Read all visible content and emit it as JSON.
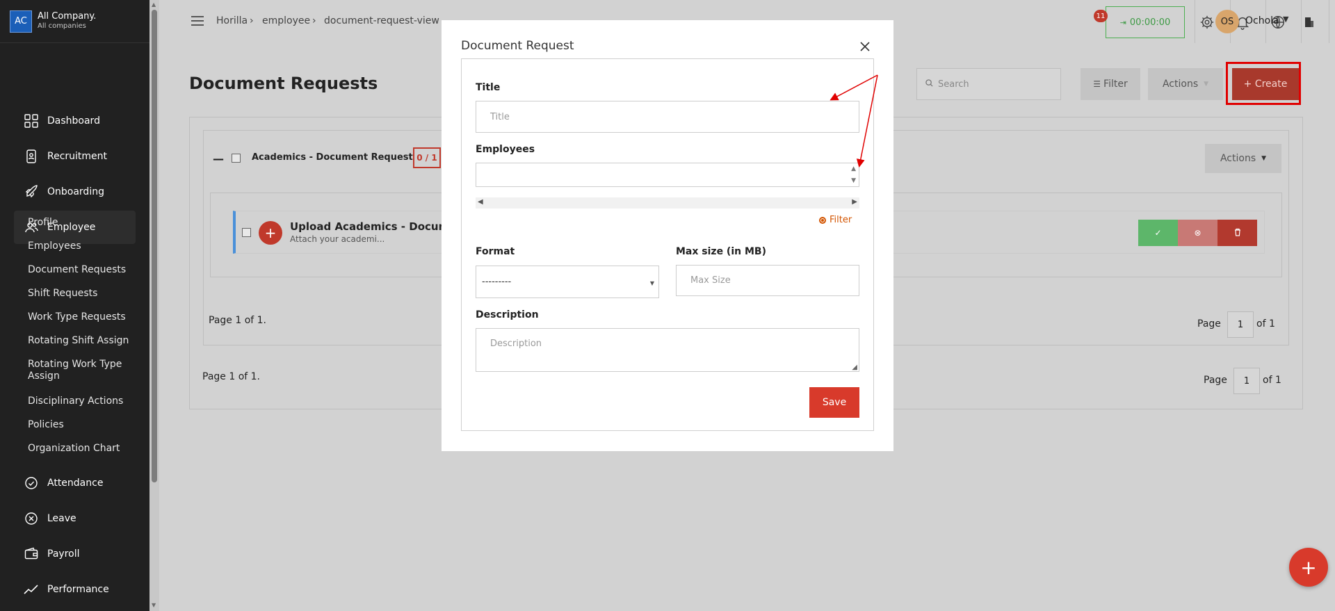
{
  "company": {
    "logo_text": "AC",
    "name": "All Company.",
    "subtitle": "All companies"
  },
  "nav": {
    "items": [
      {
        "label": "Dashboard",
        "icon": "dashboard-icon"
      },
      {
        "label": "Recruitment",
        "icon": "recruitment-icon"
      },
      {
        "label": "Onboarding",
        "icon": "rocket-icon"
      },
      {
        "label": "Employee",
        "icon": "users-icon"
      },
      {
        "label": "Attendance",
        "icon": "check-circle-icon"
      },
      {
        "label": "Leave",
        "icon": "x-circle-icon"
      },
      {
        "label": "Payroll",
        "icon": "wallet-icon"
      },
      {
        "label": "Performance",
        "icon": "trend-icon"
      }
    ],
    "employee_sub": [
      "Profile",
      "Employees",
      "Document Requests",
      "Shift Requests",
      "Work Type Requests",
      "Rotating Shift Assign",
      "Rotating Work Type Assign",
      "Disciplinary Actions",
      "Policies",
      "Organization Chart"
    ]
  },
  "breadcrumb": [
    "Horilla",
    "employee",
    "document-request-view"
  ],
  "topbar": {
    "timer": "00:00:00",
    "notification_count": "11",
    "user_initials": "OS",
    "user_name": "Ochola"
  },
  "page": {
    "title": "Document Requests",
    "search_placeholder": "Search",
    "filter_label": "Filter",
    "actions_label": "Actions",
    "create_label": "+ Create"
  },
  "group": {
    "title": "Academics - Document Request",
    "count": "0 / 1",
    "actions_label": "Actions",
    "row_title": "Upload Academics - Documen",
    "row_subtitle": "Attach your academi..."
  },
  "pagination": {
    "inner_text": "Page 1 of 1.",
    "outer_text": "Page 1 of 1.",
    "page_label": "Page",
    "page_value": "1",
    "of_label": "of 1"
  },
  "modal": {
    "title": "Document Request",
    "title_label": "Title",
    "title_placeholder": "Title",
    "employees_label": "Employees",
    "filter_link": "Filter",
    "format_label": "Format",
    "format_value": "---------",
    "max_size_label": "Max size (in MB)",
    "max_size_placeholder": "Max Size",
    "description_label": "Description",
    "description_placeholder": "Description",
    "save_label": "Save"
  },
  "colors": {
    "accent": "#d83a2b",
    "sidebar": "#212121",
    "timer": "#3d9a44",
    "highlight": "#e00000",
    "annotation_arrow": "#e00000"
  }
}
